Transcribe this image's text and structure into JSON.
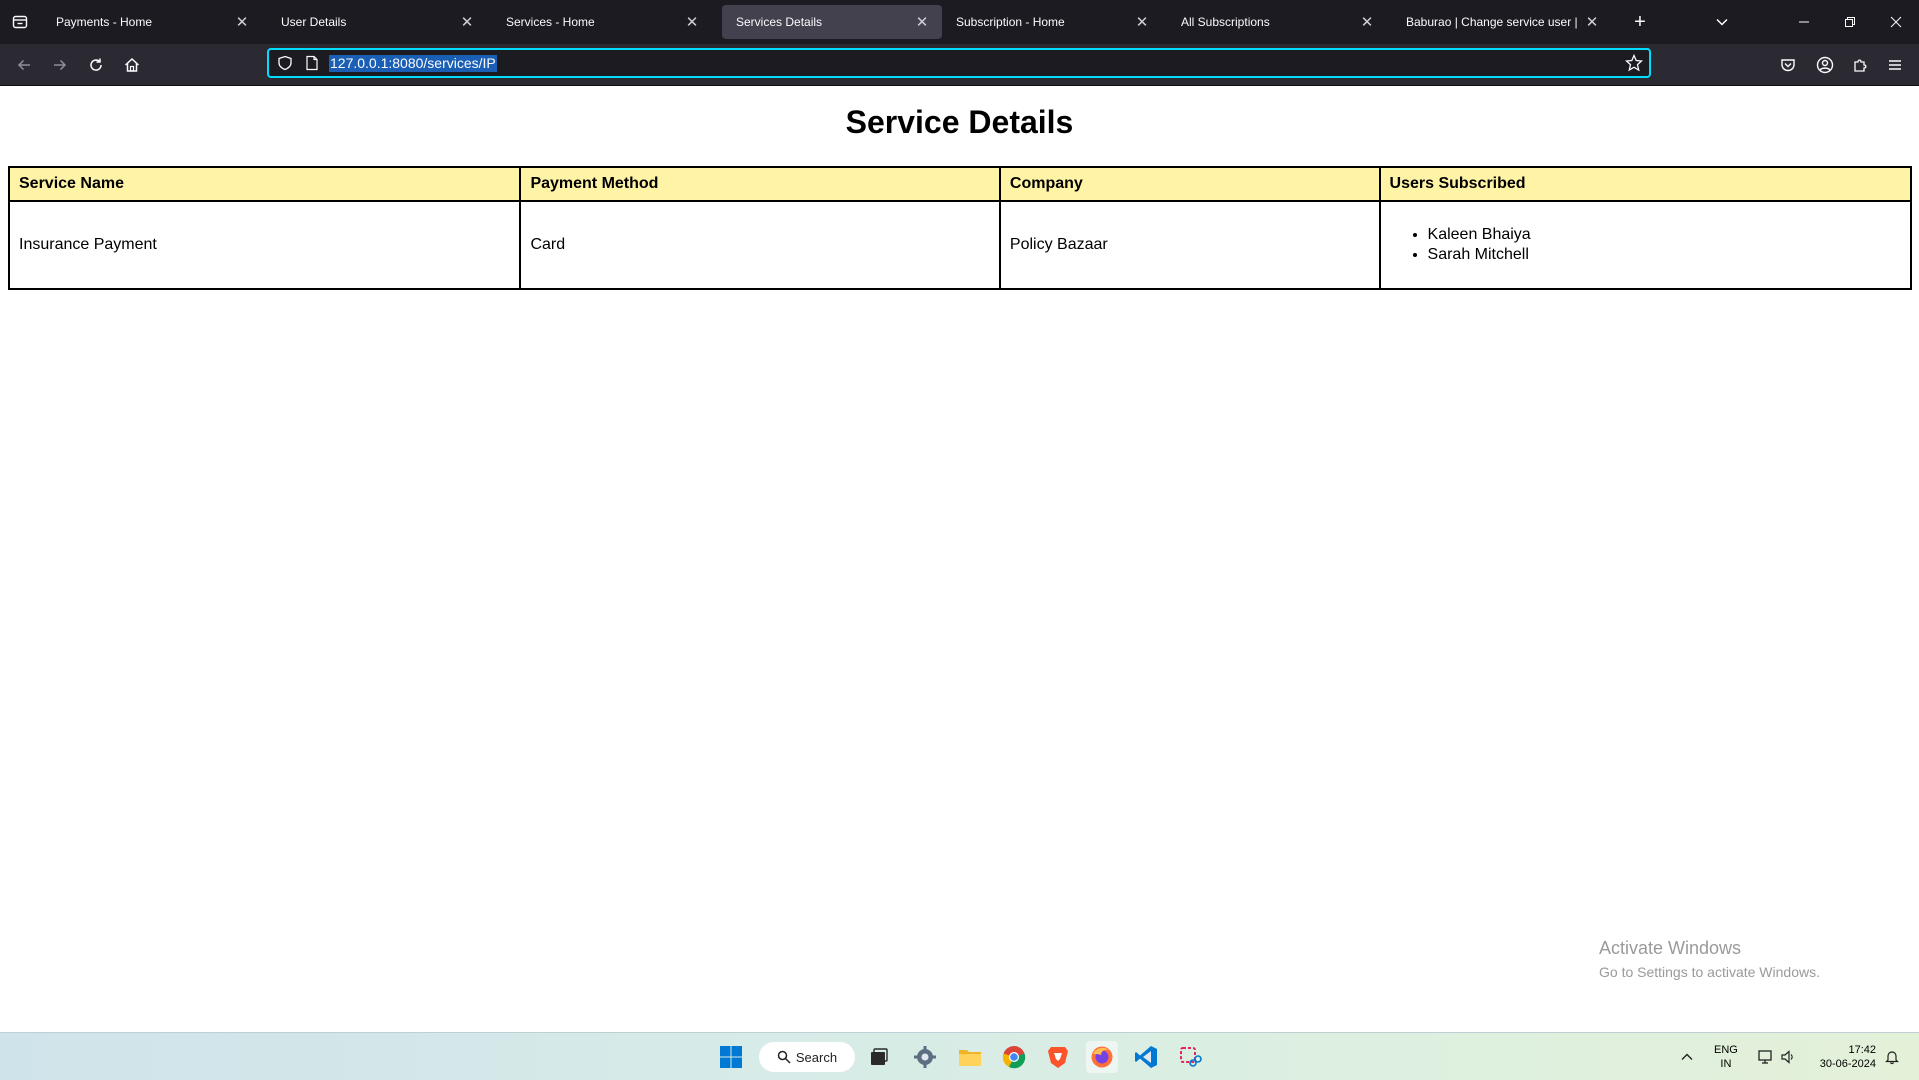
{
  "browser": {
    "tabs": [
      {
        "label": "Payments - Home",
        "active": false
      },
      {
        "label": "User Details",
        "active": false
      },
      {
        "label": "Services - Home",
        "active": false
      },
      {
        "label": "Services Details",
        "active": true
      },
      {
        "label": "Subscription - Home",
        "active": false
      },
      {
        "label": "All Subscriptions",
        "active": false
      },
      {
        "label": "Baburao | Change service user | Djan",
        "active": false
      }
    ],
    "address": "127.0.0.1:8080/services/IP"
  },
  "page": {
    "title": "Service Details",
    "table": {
      "headers": [
        "Service Name",
        "Payment Method",
        "Company",
        "Users Subscribed"
      ],
      "row": {
        "service_name": "Insurance Payment",
        "payment_method": "Card",
        "company": "Policy Bazaar",
        "users": [
          "Kaleen Bhaiya",
          "Sarah Mitchell"
        ]
      }
    }
  },
  "watermark": {
    "line1": "Activate Windows",
    "line2": "Go to Settings to activate Windows."
  },
  "taskbar": {
    "search_label": "Search",
    "lang_line1": "ENG",
    "lang_line2": "IN",
    "time": "17:42",
    "date": "30-06-2024"
  },
  "colors": {
    "table_header_bg": "#fff3a6",
    "url_focus_border": "#00ddff",
    "tab_bar_bg": "#1c1b22",
    "nav_bar_bg": "#2b2a33"
  }
}
